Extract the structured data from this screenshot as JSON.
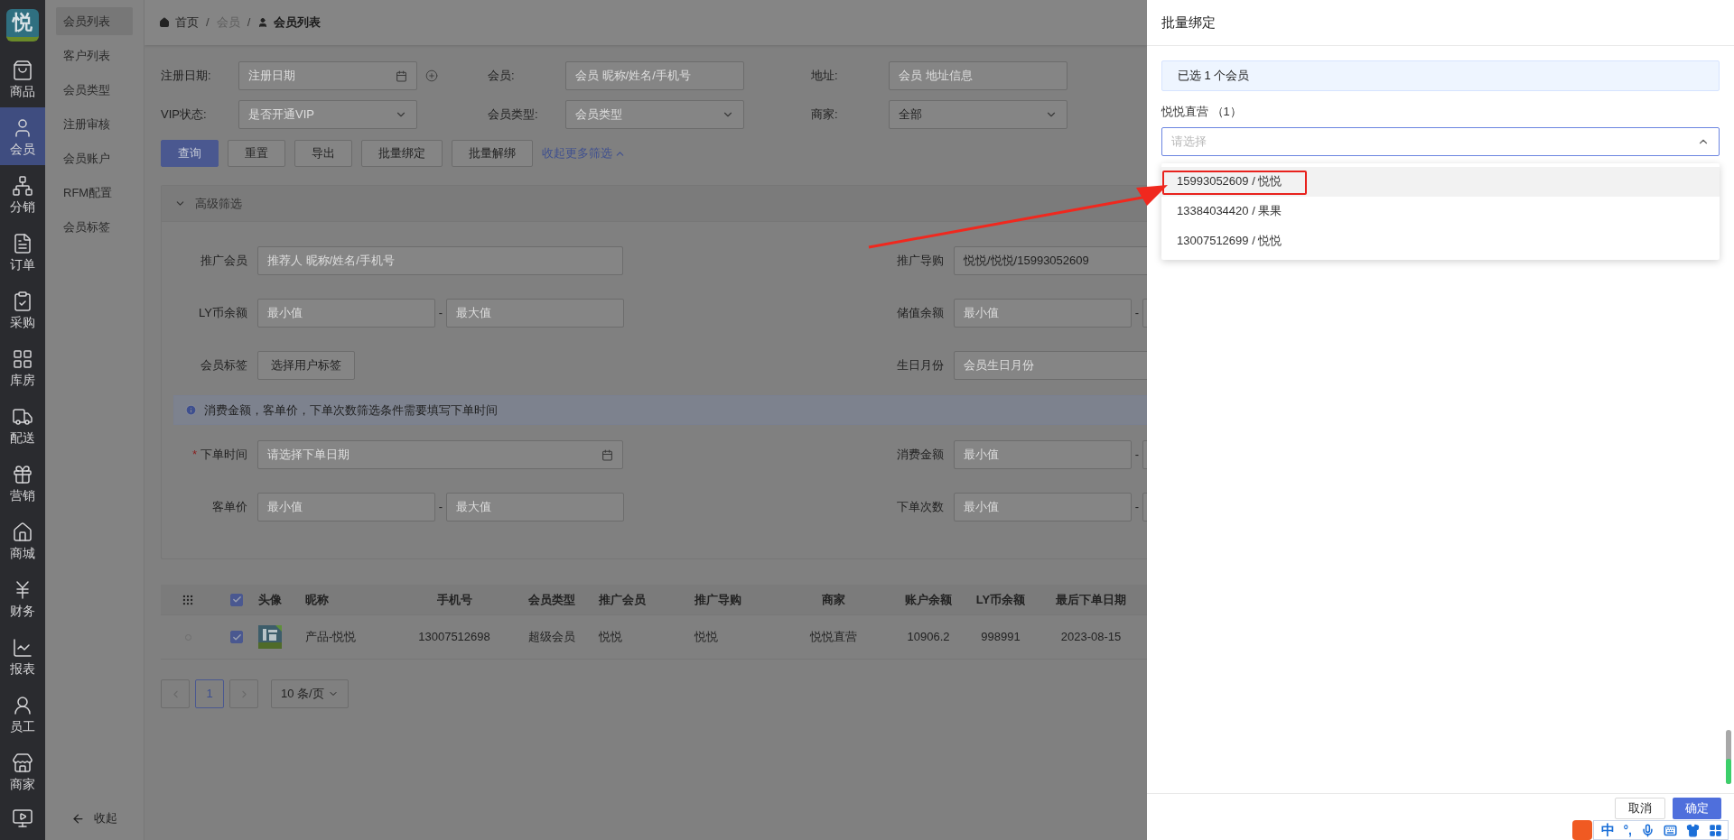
{
  "logo": {
    "text": "悦"
  },
  "nav": [
    {
      "label": "商品",
      "selected": false
    },
    {
      "label": "会员",
      "selected": true
    },
    {
      "label": "分销",
      "selected": false
    },
    {
      "label": "订单",
      "selected": false
    },
    {
      "label": "采购",
      "selected": false
    },
    {
      "label": "库房",
      "selected": false
    },
    {
      "label": "配送",
      "selected": false
    },
    {
      "label": "营销",
      "selected": false
    },
    {
      "label": "商城",
      "selected": false
    },
    {
      "label": "财务",
      "selected": false
    },
    {
      "label": "报表",
      "selected": false
    },
    {
      "label": "员工",
      "selected": false
    },
    {
      "label": "商家",
      "selected": false
    }
  ],
  "subnav": {
    "items": [
      {
        "label": "会员列表",
        "selected": true
      },
      {
        "label": "客户列表",
        "selected": false
      },
      {
        "label": "会员类型",
        "selected": false
      },
      {
        "label": "注册审核",
        "selected": false
      },
      {
        "label": "会员账户",
        "selected": false
      },
      {
        "label": "RFM配置",
        "selected": false
      },
      {
        "label": "会员标签",
        "selected": false
      }
    ],
    "collapse": "收起"
  },
  "breadcrumb": {
    "separator": "/",
    "items": [
      "首页",
      "会员",
      "会员列表"
    ]
  },
  "filters": {
    "fields": [
      {
        "label": "注册日期:",
        "kind": "date_add",
        "placeholder": "注册日期"
      },
      {
        "label": "会员:",
        "kind": "input",
        "placeholder": "会员 昵称/姓名/手机号"
      },
      {
        "label": "地址:",
        "kind": "input",
        "placeholder": "会员 地址信息"
      },
      {
        "label": "VIP状态:",
        "kind": "select",
        "placeholder": "是否开通VIP"
      },
      {
        "label": "会员类型:",
        "kind": "select",
        "placeholder": "会员类型"
      },
      {
        "label": "商家:",
        "kind": "select",
        "value": "全部"
      }
    ],
    "buttons": [
      {
        "label": "查询",
        "primary": true
      },
      {
        "label": "重置",
        "primary": false
      },
      {
        "label": "导出",
        "primary": false
      },
      {
        "label": "批量绑定",
        "primary": false
      },
      {
        "label": "批量解绑",
        "primary": false
      }
    ],
    "toggle_link": "收起更多筛选"
  },
  "advanced": {
    "title": "高级筛选",
    "expanded": true,
    "required_mark": "*",
    "range_separator": "-",
    "rows": [
      {
        "kind": "fields",
        "items": [
          {
            "label": "推广会员",
            "kind": "input",
            "required": false,
            "placeholder": "推荐人 昵称/姓名/手机号"
          },
          {
            "label": "推广导购",
            "kind": "input",
            "required": false,
            "value": "悦悦/悦悦/15993052609"
          }
        ]
      },
      {
        "kind": "fields",
        "items": [
          {
            "label": "LY币余额",
            "kind": "range",
            "required": false,
            "min_placeholder": "最小值",
            "max_placeholder": "最大值"
          },
          {
            "label": "储值余额",
            "kind": "range",
            "required": false,
            "min_placeholder": "最小值"
          }
        ]
      },
      {
        "kind": "fields",
        "items": [
          {
            "label": "会员标签",
            "kind": "button",
            "required": false,
            "button": "选择用户标签"
          },
          {
            "label": "生日月份",
            "kind": "input",
            "required": false,
            "placeholder": "会员生日月份"
          }
        ]
      },
      {
        "kind": "notice",
        "text": "消费金额，客单价，下单次数筛选条件需要填写下单时间"
      },
      {
        "kind": "fields",
        "items": [
          {
            "label": "下单时间",
            "kind": "date",
            "required": true,
            "placeholder": "请选择下单日期"
          },
          {
            "label": "消费金额",
            "kind": "range",
            "required": false,
            "min_placeholder": "最小值"
          }
        ]
      },
      {
        "kind": "fields",
        "items": [
          {
            "label": "客单价",
            "kind": "range",
            "required": false,
            "min_placeholder": "最小值",
            "max_placeholder": "最大值"
          },
          {
            "label": "下单次数",
            "kind": "range",
            "required": false,
            "min_placeholder": "最小值"
          }
        ]
      }
    ]
  },
  "table": {
    "all_checked": true,
    "columns": [
      "头像",
      "昵称",
      "手机号",
      "会员类型",
      "推广会员",
      "推广导购",
      "商家",
      "账户余额",
      "LY币余额",
      "最后下单日期"
    ],
    "rows": [
      {
        "checked": true,
        "cells": [
          {
            "kind": "picture"
          },
          "产品-悦悦",
          "13007512698",
          "超级会员",
          "悦悦",
          "悦悦",
          "悦悦直营",
          "10906.2",
          "998991",
          "2023-08-15"
        ]
      }
    ]
  },
  "pagination": {
    "pages": [
      {
        "label": "1",
        "selected": true
      }
    ],
    "page_size": "10 条/页"
  },
  "drawer": {
    "title": "批量绑定",
    "notice": "已选 1 个会员",
    "groups": [
      {
        "label": "悦悦直营 （1）",
        "placeholder": "请选择",
        "open": true,
        "options": [
          {
            "label": "15993052609 / 悦悦",
            "hovered": true,
            "highlighted": true
          },
          {
            "label": "13384034420 / 果果",
            "hovered": false,
            "highlighted": false
          },
          {
            "label": "13007512699 / 悦悦",
            "hovered": false,
            "highlighted": false
          }
        ]
      }
    ],
    "buttons": [
      {
        "label": "取消",
        "primary": false
      },
      {
        "label": "确定",
        "primary": true
      }
    ]
  },
  "ime": {
    "mode": "中",
    "punct": "°,"
  }
}
